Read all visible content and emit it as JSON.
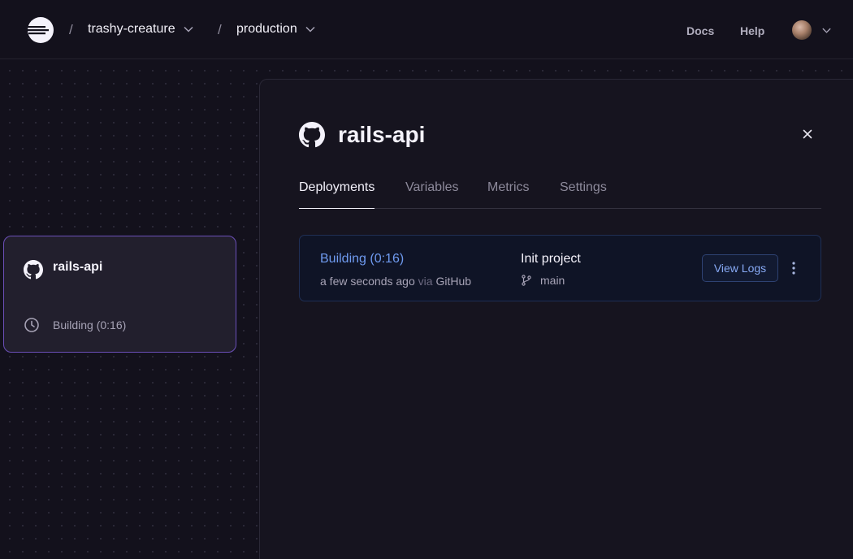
{
  "header": {
    "logo_icon": "railway-logo-icon",
    "breadcrumbs": [
      {
        "label": "trashy-creature"
      },
      {
        "label": "production"
      }
    ],
    "separator": "/",
    "links": {
      "docs": "Docs",
      "help": "Help"
    }
  },
  "canvas": {
    "service_card": {
      "title": "rails-api",
      "status": "Building (0:16)",
      "icon": "github-icon"
    }
  },
  "panel": {
    "title": "rails-api",
    "icon": "github-icon",
    "tabs": [
      {
        "label": "Deployments",
        "active": true
      },
      {
        "label": "Variables",
        "active": false
      },
      {
        "label": "Metrics",
        "active": false
      },
      {
        "label": "Settings",
        "active": false
      }
    ],
    "deployments": [
      {
        "status": "Building (0:16)",
        "time": "a few seconds ago",
        "via": "via",
        "source": "GitHub",
        "commit_message": "Init project",
        "branch": "main",
        "view_logs_label": "View Logs"
      }
    ]
  },
  "colors": {
    "background": "#13111c",
    "accent_purple": "#6b4fb8",
    "status_blue": "#6f9bf0",
    "deploy_row_bg": "#0f1426"
  }
}
